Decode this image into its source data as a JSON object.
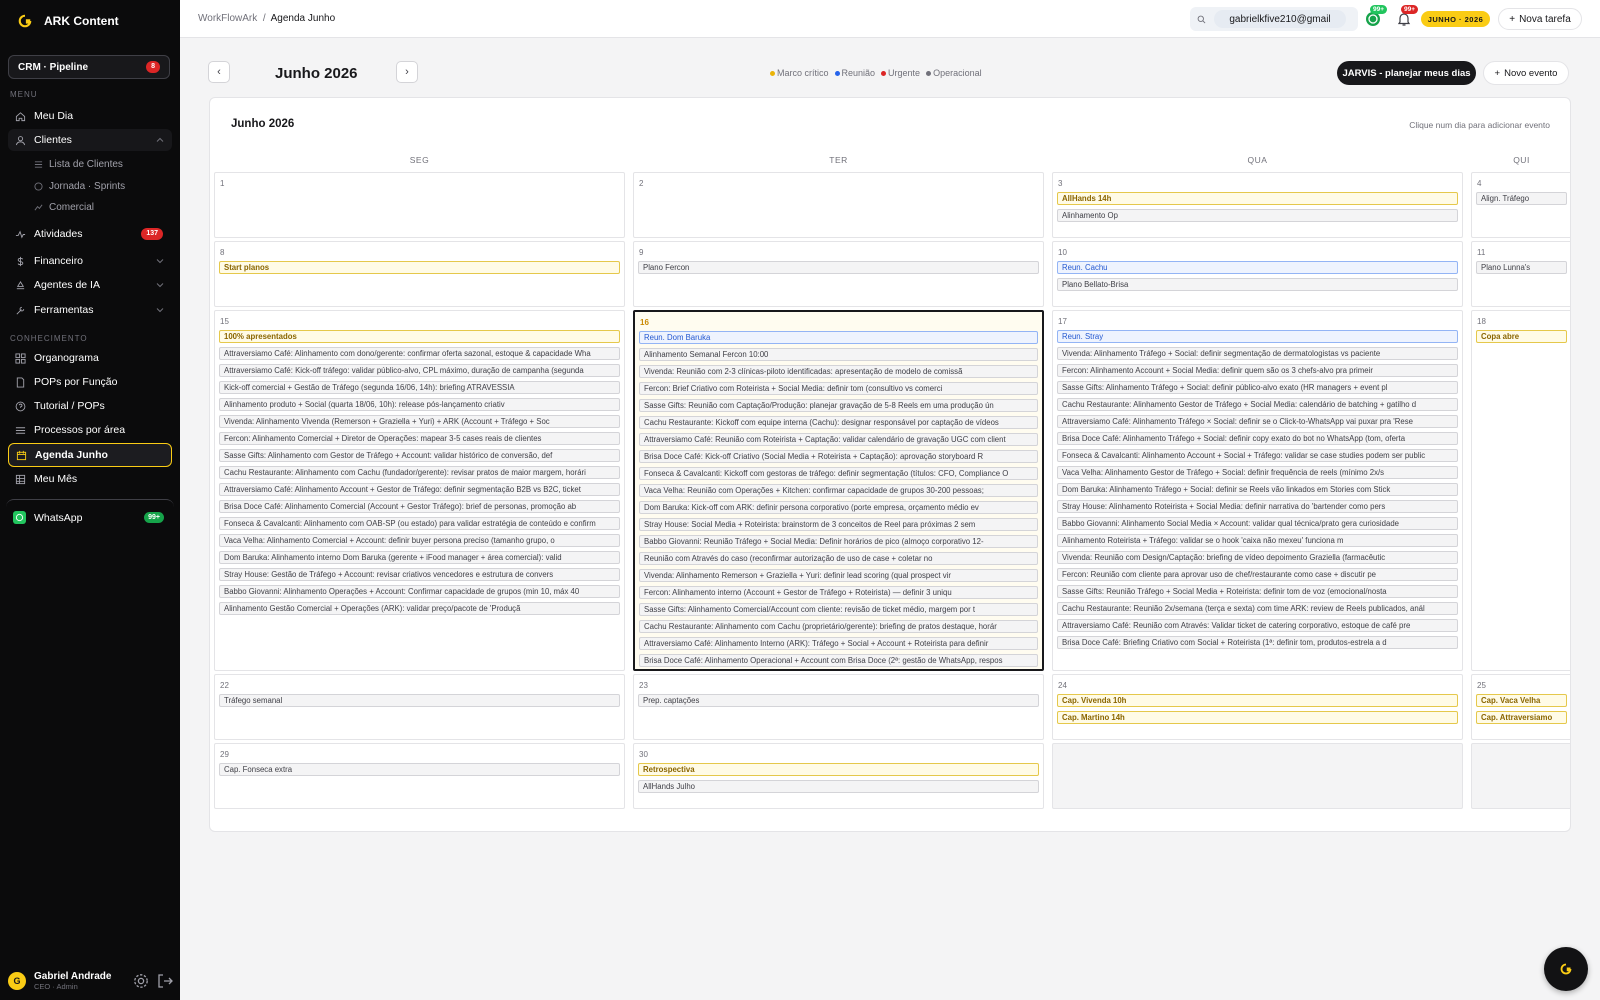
{
  "app": {
    "brand": "ARK Content",
    "pipeline_label": "CRM · Pipeline",
    "pipeline_badge": "8",
    "whatsapp_label": "WhatsApp",
    "whatsapp_badge": "99+"
  },
  "sidebar": {
    "menu_label": "MENU",
    "knowledge_label": "CONHECIMENTO",
    "items": [
      {
        "label": "Meu Dia",
        "icon": "home-icon"
      },
      {
        "label": "Clientes",
        "icon": "user-icon"
      },
      {
        "label": "Atividades",
        "icon": "activity-icon",
        "badge": "137"
      },
      {
        "label": "Financeiro",
        "icon": "dollar-icon"
      },
      {
        "label": "Agentes de IA",
        "icon": "bot-icon"
      },
      {
        "label": "Ferramentas",
        "icon": "wrench-icon"
      }
    ],
    "clientes_sub": [
      "Lista de Clientes",
      "Jornada · Sprints",
      "Comercial"
    ],
    "knowledge": [
      {
        "label": "Organograma",
        "icon": "grid-icon"
      },
      {
        "label": "POPs por Função",
        "icon": "document-icon"
      },
      {
        "label": "Tutorial / POPs",
        "icon": "help-icon"
      },
      {
        "label": "Processos por área",
        "icon": "list-icon"
      },
      {
        "label": "Agenda Junho",
        "icon": "calendar-icon"
      },
      {
        "label": "Meu Mês",
        "icon": "table-icon"
      }
    ]
  },
  "user": {
    "initial": "G",
    "name": "Gabriel Andrade",
    "role": "CEO · Admin"
  },
  "header": {
    "breadcrumb_root": "WorkFlowArk",
    "breadcrumb_sep": "/",
    "breadcrumb_current": "Agenda Junho",
    "search_value": "gabrielkfive210@gmail",
    "whatsapp_badge": "99+",
    "notif_badge": "99+",
    "date_pill": "JUNHO · 2026",
    "new_task": "Nova tarefa"
  },
  "toolbar": {
    "prev": "‹",
    "next": "›",
    "month_title": "Junho 2026",
    "legend": [
      {
        "label": "Marco crítico",
        "color": "#eab308"
      },
      {
        "label": "Reunião",
        "color": "#2563eb"
      },
      {
        "label": "Urgente",
        "color": "#dc2626"
      },
      {
        "label": "Operacional",
        "color": "#71717a"
      }
    ],
    "jarvis": "JARVIS - planejar meus dias",
    "new_event": "Novo evento"
  },
  "calendar": {
    "title": "Junho 2026",
    "hint": "Clique num dia para adicionar evento",
    "days_of_week": [
      "SEG",
      "TER",
      "QUA",
      "QUI"
    ],
    "overflow_days": [
      "5",
      "1",
      "1",
      "1",
      "2"
    ],
    "weeks": [
      [
        {
          "day": "1",
          "events": []
        },
        {
          "day": "2",
          "events": []
        },
        {
          "day": "3",
          "events": [
            {
              "text": "AllHands 14h",
              "kind": "y"
            },
            {
              "text": "Alinhamento Op",
              "kind": "g"
            }
          ]
        },
        {
          "day": "4",
          "events": [
            {
              "text": "Align. Tráfego",
              "kind": "g"
            }
          ]
        }
      ],
      [
        {
          "day": "8",
          "events": [
            {
              "text": "Start planos",
              "kind": "y"
            }
          ]
        },
        {
          "day": "9",
          "events": [
            {
              "text": "Plano Fercon",
              "kind": "g"
            }
          ]
        },
        {
          "day": "10",
          "events": [
            {
              "text": "Reun. Cachu",
              "kind": "b"
            },
            {
              "text": "Plano Bellato-Brisa",
              "kind": "g"
            }
          ]
        },
        {
          "day": "11",
          "events": [
            {
              "text": "Plano Lunna's",
              "kind": "g"
            }
          ]
        }
      ],
      [
        {
          "day": "15",
          "events": [
            {
              "text": "100% apresentados",
              "kind": "y"
            },
            {
              "text": "Attraversiamo Café: Alinhamento com dono/gerente: confirmar oferta sazonal, estoque & capacidade Wha",
              "kind": "g"
            },
            {
              "text": "Attraversiamo Café: Kick-off tráfego: validar público-alvo, CPL máximo, duração de campanha (segunda",
              "kind": "g"
            },
            {
              "text": "Kick-off comercial + Gestão de Tráfego (segunda 16/06, 14h): briefing ATRAVESSIA",
              "kind": "g"
            },
            {
              "text": "Alinhamento produto + Social (quarta 18/06, 10h): release pós-lançamento criativ",
              "kind": "g"
            },
            {
              "text": "Vivenda: Alinhamento Vivenda (Remerson + Graziella + Yuri) + ARK (Account + Tráfego + Soc",
              "kind": "g"
            },
            {
              "text": "Fercon: Alinhamento Comercial + Diretor de Operações: mapear 3-5 cases reais de clientes",
              "kind": "g"
            },
            {
              "text": "Sasse Gifts: Alinhamento com Gestor de Tráfego + Account: validar histórico de conversão, def",
              "kind": "g"
            },
            {
              "text": "Cachu Restaurante: Alinhamento com Cachu (fundador/gerente): revisar pratos de maior margem, horári",
              "kind": "g"
            },
            {
              "text": "Attraversiamo Café: Alinhamento Account + Gestor de Tráfego: definir segmentação B2B vs B2C, ticket",
              "kind": "g"
            },
            {
              "text": "Brisa Doce Café: Alinhamento Comercial (Account + Gestor Tráfego): brief de personas, promoção ab",
              "kind": "g"
            },
            {
              "text": "Fonseca & Cavalcanti: Alinhamento com OAB-SP (ou estado) para validar estratégia de conteúdo e confirm",
              "kind": "g"
            },
            {
              "text": "Vaca Velha: Alinhamento Comercial + Account: definir buyer persona preciso (tamanho grupo, o",
              "kind": "g"
            },
            {
              "text": "Dom Baruka: Alinhamento interno Dom Baruka (gerente + iFood manager + área comercial): valid",
              "kind": "g"
            },
            {
              "text": "Stray House: Gestão de Tráfego + Account: revisar criativos vencedores e estrutura de convers",
              "kind": "g"
            },
            {
              "text": "Babbo Giovanni: Alinhamento Operações + Account: Confirmar capacidade de grupos (min 10, máx 40",
              "kind": "g"
            },
            {
              "text": "Alinhamento Gestão Comercial + Operações (ARK): validar preço/pacote de 'Produçã",
              "kind": "g"
            }
          ]
        },
        {
          "day": "16",
          "today": true,
          "events": [
            {
              "text": "Reun. Dom Baruka",
              "kind": "b"
            },
            {
              "text": "Alinhamento Semanal Fercon 10:00",
              "kind": "g"
            },
            {
              "text": "Vivenda: Reunião com 2-3 clínicas-piloto identificadas: apresentação de modelo de comissã",
              "kind": "g"
            },
            {
              "text": "Fercon: Brief Criativo com Roteirista + Social Media: definir tom (consultivo vs comerci",
              "kind": "g"
            },
            {
              "text": "Sasse Gifts: Reunião com Captação/Produção: planejar gravação de 5-8 Reels em uma produção ún",
              "kind": "g"
            },
            {
              "text": "Cachu Restaurante: Kickoff com equipe interna (Cachu): designar responsável por captação de vídeos",
              "kind": "g"
            },
            {
              "text": "Attraversiamo Café: Reunião com Roteirista + Captação: validar calendário de gravação UGC com client",
              "kind": "g"
            },
            {
              "text": "Brisa Doce Café: Kick-off Criativo (Social Media + Roteirista + Captação): aprovação storyboard R",
              "kind": "g"
            },
            {
              "text": "Fonseca & Cavalcanti: Kickoff com gestoras de tráfego: definir segmentação (títulos: CFO, Compliance O",
              "kind": "g"
            },
            {
              "text": "Vaca Velha: Reunião com Operações + Kitchen: confirmar capacidade de grupos 30-200 pessoas;",
              "kind": "g"
            },
            {
              "text": "Dom Baruka: Kick-off com ARK: definir persona corporativo (porte empresa, orçamento médio ev",
              "kind": "g"
            },
            {
              "text": "Stray House: Social Media + Roteirista: brainstorm de 3 conceitos de Reel para próximas 2 sem",
              "kind": "g"
            },
            {
              "text": "Babbo Giovanni: Reunião Tráfego + Social Media: Definir horários de pico (almoço corporativo 12-",
              "kind": "g"
            },
            {
              "text": "Reunião com Através do caso (reconfirmar autorização de uso de case + coletar no",
              "kind": "g"
            },
            {
              "text": "Vivenda: Alinhamento Remerson + Graziella + Yuri: definir lead scoring (qual prospect vir",
              "kind": "g"
            },
            {
              "text": "Fercon: Alinhamento interno (Account + Gestor de Tráfego + Roteirista) — definir 3 uniqu",
              "kind": "g"
            },
            {
              "text": "Sasse Gifts: Alinhamento Comercial/Account com cliente: revisão de ticket médio, margem por t",
              "kind": "g"
            },
            {
              "text": "Cachu Restaurante: Alinhamento com Cachu (proprietário/gerente): briefing de pratos destaque, horár",
              "kind": "g"
            },
            {
              "text": "Attraversiamo Café: Alinhamento Interno (ARK): Tráfego + Social + Account + Roteirista para definir",
              "kind": "g"
            },
            {
              "text": "Brisa Doce Café: Alinhamento Operacional + Account com Brisa Doce (2ª: gestão de WhatsApp, respos",
              "kind": "g"
            }
          ]
        },
        {
          "day": "17",
          "events": [
            {
              "text": "Reun. Stray",
              "kind": "b"
            },
            {
              "text": "Vivenda: Alinhamento Tráfego + Social: definir segmentação de dermatologistas vs paciente",
              "kind": "g"
            },
            {
              "text": "Fercon: Alinhamento Account + Social Media: definir quem são os 3 chefs-alvo pra primeir",
              "kind": "g"
            },
            {
              "text": "Sasse Gifts: Alinhamento Tráfego + Social: definir público-alvo exato (HR managers + event pl",
              "kind": "g"
            },
            {
              "text": "Cachu Restaurante: Alinhamento Gestor de Tráfego + Social Media: calendário de batching + gatilho d",
              "kind": "g"
            },
            {
              "text": "Attraversiamo Café: Alinhamento Tráfego × Social: definir se o Click-to-WhatsApp vai puxar pra 'Rese",
              "kind": "g"
            },
            {
              "text": "Brisa Doce Café: Alinhamento Tráfego + Social: definir copy exato do bot no WhatsApp (tom, oferta",
              "kind": "g"
            },
            {
              "text": "Fonseca & Cavalcanti: Alinhamento Account + Social + Tráfego: validar se case studies podem ser public",
              "kind": "g"
            },
            {
              "text": "Vaca Velha: Alinhamento Gestor de Tráfego + Social: definir frequência de reels (mínimo 2x/s",
              "kind": "g"
            },
            {
              "text": "Dom Baruka: Alinhamento Tráfego + Social: definir se Reels vão linkados em Stories com Stick",
              "kind": "g"
            },
            {
              "text": "Stray House: Alinhamento Roteirista + Social Media: definir narrativa do 'bartender como pers",
              "kind": "g"
            },
            {
              "text": "Babbo Giovanni: Alinhamento Social Media × Account: validar qual técnica/prato gera curiosidade",
              "kind": "g"
            },
            {
              "text": "Alinhamento Roteirista + Tráfego: validar se o hook 'caixa não mexeu' funciona m",
              "kind": "g"
            },
            {
              "text": "Vivenda: Reunião com Design/Captação: briefing de vídeo depoimento Graziella (farmacêutic",
              "kind": "g"
            },
            {
              "text": "Fercon: Reunião com cliente para aprovar uso de chef/restaurante como case + discutir pe",
              "kind": "g"
            },
            {
              "text": "Sasse Gifts: Reunião Tráfego + Social Media + Roteirista: definir tom de voz (emocional/nosta",
              "kind": "g"
            },
            {
              "text": "Cachu Restaurante: Reunião 2x/semana (terça e sexta) com time ARK: review de Reels publicados, anál",
              "kind": "g"
            },
            {
              "text": "Attraversiamo Café: Reunião com Através: Validar ticket de catering corporativo, estoque de café pre",
              "kind": "g"
            },
            {
              "text": "Brisa Doce Café: Briefing Criativo com Social + Roteirista (1ª: definir tom, produtos-estrela a d",
              "kind": "g"
            }
          ]
        },
        {
          "day": "18",
          "events": [
            {
              "text": "Copa abre",
              "kind": "y"
            }
          ]
        }
      ],
      [
        {
          "day": "22",
          "events": [
            {
              "text": "Tráfego semanal",
              "kind": "g"
            }
          ]
        },
        {
          "day": "23",
          "events": [
            {
              "text": "Prep. captações",
              "kind": "g"
            }
          ]
        },
        {
          "day": "24",
          "events": [
            {
              "text": "Cap. Vivenda 10h",
              "kind": "y"
            },
            {
              "text": "Cap. Martino 14h",
              "kind": "y"
            }
          ]
        },
        {
          "day": "25",
          "events": [
            {
              "text": "Cap. Vaca Velha",
              "kind": "y"
            },
            {
              "text": "Cap. Attraversiamo",
              "kind": "y"
            }
          ]
        }
      ],
      [
        {
          "day": "29",
          "events": [
            {
              "text": "Cap. Fonseca extra",
              "kind": "g"
            }
          ]
        },
        {
          "day": "30",
          "events": [
            {
              "text": "Retrospectiva",
              "kind": "y"
            },
            {
              "text": "AllHands Julho",
              "kind": "g"
            }
          ]
        },
        {
          "day": "",
          "empty": true,
          "events": []
        },
        {
          "day": "",
          "empty": true,
          "events": []
        }
      ]
    ]
  }
}
